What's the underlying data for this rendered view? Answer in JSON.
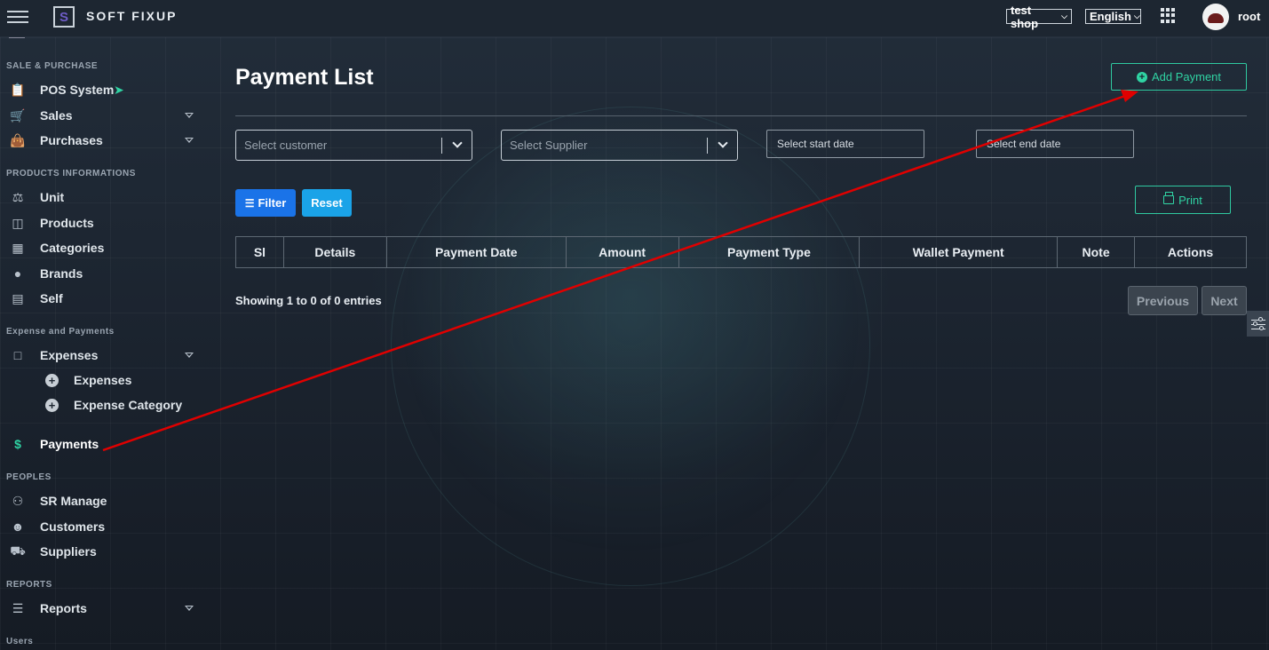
{
  "topbar": {
    "brand": "SOFT FIXUP",
    "logo_letter": "S",
    "shop_select": "test shop",
    "language_select": "English",
    "user_name": "root"
  },
  "sidebar": {
    "sections": {
      "sale_purchase": "SALE & PURCHASE",
      "products": "PRODUCTS INFORMATIONS",
      "expense": "Expense and Payments",
      "peoples": "PEOPLES",
      "reports": "REPORTS",
      "users": "Users"
    },
    "items": {
      "pos": "POS System",
      "sales": "Sales",
      "purchases": "Purchases",
      "unit": "Unit",
      "products": "Products",
      "categories": "Categories",
      "brands": "Brands",
      "self": "Self",
      "expenses": "Expenses",
      "expenses_sub": "Expenses",
      "expense_category": "Expense Category",
      "payments": "Payments",
      "sr_manage": "SR Manage",
      "customers": "Customers",
      "suppliers": "Suppliers",
      "reports": "Reports"
    },
    "dollar_icon_glyph": "$"
  },
  "main": {
    "title": "Payment List",
    "add_button": "Add Payment",
    "customer_placeholder": "Select customer",
    "supplier_placeholder": "Select Supplier",
    "start_date_placeholder": "Select start date",
    "end_date_placeholder": "Select end date",
    "filter_button": "Filter",
    "reset_button": "Reset",
    "print_button": "Print",
    "table": {
      "headers": [
        "Sl",
        "Details",
        "Payment Date",
        "Amount",
        "Payment Type",
        "Wallet Payment",
        "Note",
        "Actions"
      ]
    },
    "showing_text": "Showing 1 to 0 of 0 entries",
    "prev_button": "Previous",
    "next_button": "Next"
  },
  "colors": {
    "accent_green": "#2fd3a3",
    "filter_blue": "#1a73e8",
    "reset_blue": "#1aa3e8",
    "annotation_red": "#e00000"
  }
}
